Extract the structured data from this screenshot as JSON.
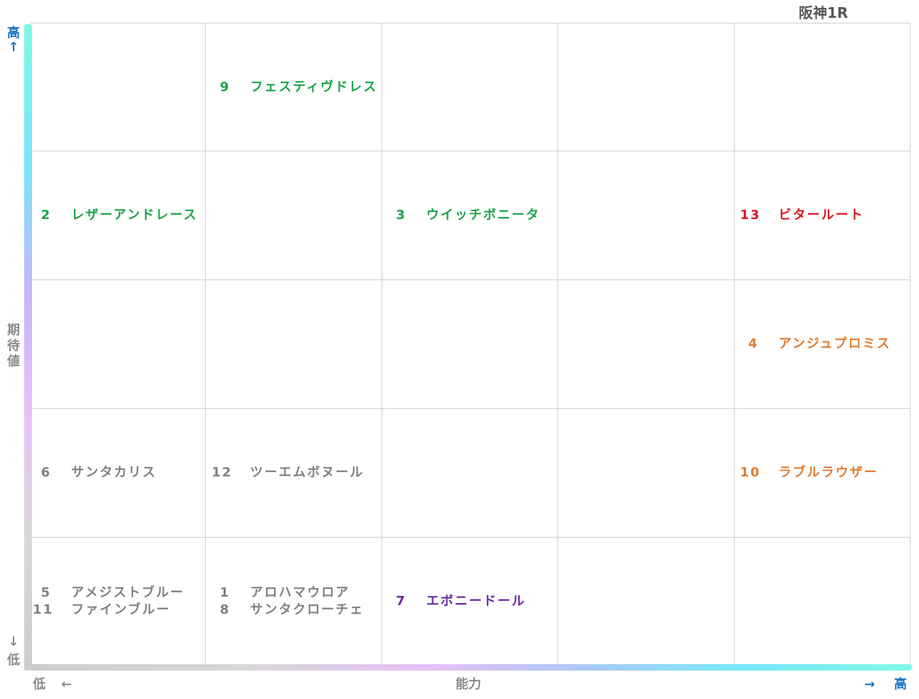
{
  "header": {
    "race": "阪神1R"
  },
  "axes": {
    "y": {
      "label": "期待値",
      "high": "高",
      "up_arrow": "↑",
      "down_arrow": "↓",
      "low": "低"
    },
    "x": {
      "label": "能力",
      "low": "低",
      "left_arrow": "←",
      "right_arrow": "→",
      "high": "高"
    }
  },
  "colors": {
    "green": "#1aa34a",
    "red": "#e0141e",
    "orange": "#e07c30",
    "purple": "#6a2aa0",
    "gray": "#808080",
    "axis_blue": "#1a74c4"
  },
  "chart_data": {
    "type": "table",
    "columns": 5,
    "rows": 5,
    "x_axis": "能力",
    "y_axis": "期待値",
    "cells": [
      {
        "col": 2,
        "row": 1,
        "horses": [
          {
            "num": "9",
            "name": "フェスティヴドレス",
            "color": "green"
          }
        ]
      },
      {
        "col": 1,
        "row": 2,
        "horses": [
          {
            "num": "2",
            "name": "レザーアンドレース",
            "color": "green"
          }
        ]
      },
      {
        "col": 3,
        "row": 2,
        "horses": [
          {
            "num": "3",
            "name": "ウイッチボニータ",
            "color": "green"
          }
        ]
      },
      {
        "col": 5,
        "row": 2,
        "horses": [
          {
            "num": "13",
            "name": "ビタールート",
            "color": "red"
          }
        ]
      },
      {
        "col": 5,
        "row": 3,
        "horses": [
          {
            "num": "4",
            "name": "アンジュプロミス",
            "color": "orange"
          }
        ]
      },
      {
        "col": 1,
        "row": 4,
        "horses": [
          {
            "num": "6",
            "name": "サンタカリス",
            "color": "gray"
          }
        ]
      },
      {
        "col": 2,
        "row": 4,
        "horses": [
          {
            "num": "12",
            "name": "ツーエムボヌール",
            "color": "gray"
          }
        ]
      },
      {
        "col": 5,
        "row": 4,
        "horses": [
          {
            "num": "10",
            "name": "ラブルラウザー",
            "color": "orange"
          }
        ]
      },
      {
        "col": 1,
        "row": 5,
        "horses": [
          {
            "num": "5",
            "name": "アメジストブルー",
            "color": "gray"
          },
          {
            "num": "11",
            "name": "ファインブルー",
            "color": "gray"
          }
        ]
      },
      {
        "col": 2,
        "row": 5,
        "horses": [
          {
            "num": "1",
            "name": "アロハマウロア",
            "color": "gray"
          },
          {
            "num": "8",
            "name": "サンタクローチェ",
            "color": "gray"
          }
        ]
      },
      {
        "col": 3,
        "row": 5,
        "horses": [
          {
            "num": "7",
            "name": "エボニードール",
            "color": "purple"
          }
        ]
      }
    ]
  }
}
